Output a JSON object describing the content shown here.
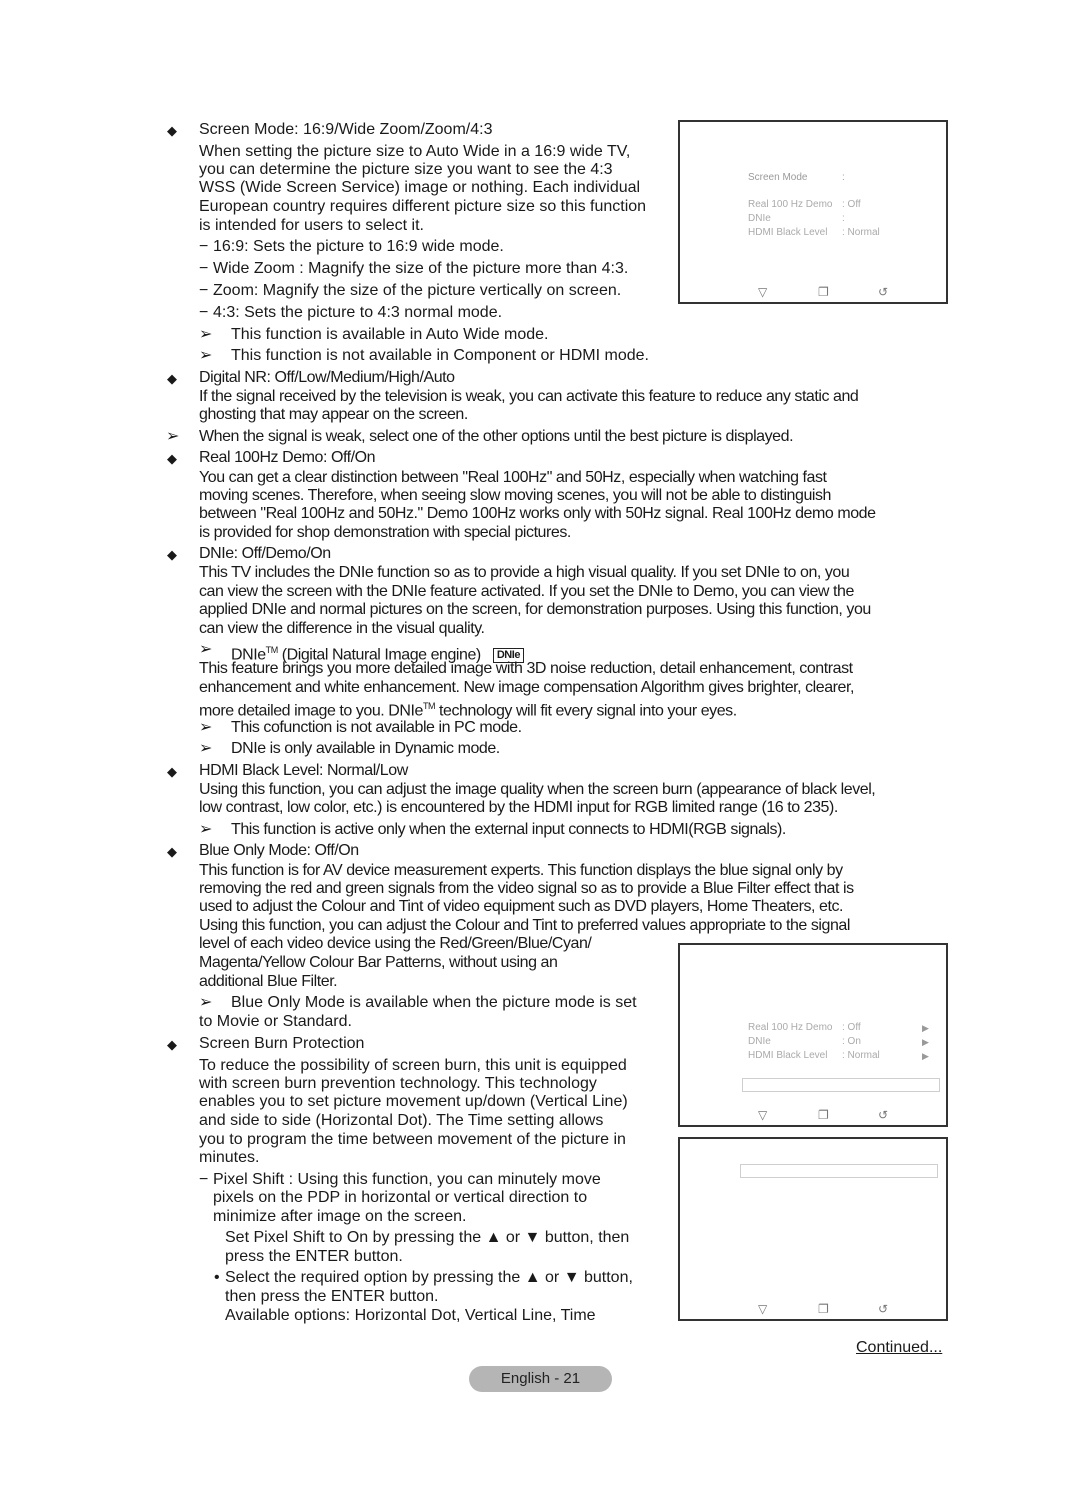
{
  "sections": {
    "screen_mode": {
      "heading": "Screen Mode: 16:9/Wide Zoom/Zoom/4:3",
      "para": [
        "When setting the picture size to Auto Wide in a 16:9 wide TV,",
        "you can determine the picture size you want to see the 4:3",
        "WSS (Wide Screen Service) image or nothing. Each individual",
        "European country requires different picture size so this function",
        "is intended for users to select it."
      ],
      "options": [
        "16:9: Sets the picture to 16:9 wide mode.",
        "Wide Zoom : Magnify the size of the picture more than 4:3.",
        "Zoom:  Magnify the size of the picture vertically on screen.",
        "4:3: Sets the picture to 4:3 normal mode."
      ],
      "notes": [
        "This function is available in Auto Wide  mode.",
        "This function is not available in Component  or HDMI mode."
      ]
    },
    "digital_nr": {
      "heading": "Digital NR: Off/Low/Medium/High/Auto",
      "para": [
        "If the signal received by the television is weak, you can activate this feature to reduce any static and",
        "ghosting that may appear on the screen."
      ],
      "note": "When the signal is weak, select one of the other options until the best picture is displayed."
    },
    "real100hz": {
      "heading": "Real 100Hz Demo: Off/On",
      "para": [
        "You can get a clear distinction between \"Real 100Hz\" and 50Hz, especially when watching fast",
        "moving scenes. Therefore, when seeing slow moving scenes, you will not be able to distinguish",
        "between \"Real 100Hz and 50Hz.\" Demo 100Hz works only with 50Hz signal. Real 100Hz demo mode",
        "is provided for shop demonstration with special pictures."
      ]
    },
    "dnie": {
      "heading": "DNIe: Off/Demo/On",
      "para": [
        "This TV includes the DNIe function so as to provide a high visual quality. If you set DNIe to on, you",
        "can view the screen with the DNIe feature activated. If you set the DNIe to Demo, you can view the",
        "applied DNIe and normal pictures on the screen, for demonstration purposes. Using this function, you",
        "can view the difference in the visual quality."
      ],
      "tm_note_prefix": "DNIe",
      "tm_sup": "TM",
      "tm_note_suffix": " (Digital Natural Image engine)",
      "badge": "DNIe",
      "para2": [
        "This feature brings you more detailed image with 3D noise reduction, detail enhancement, contrast",
        "enhancement and white enhancement. New image compensation Algorithm gives brighter, clearer,"
      ],
      "para2_last_prefix": "more detailed image to you. DNIe",
      "para2_last_sup": "TM",
      "para2_last_suffix": " technology will fit every signal into your eyes.",
      "notes": [
        "This cofunction is not available in PC mode.",
        "DNIe is only available in Dynamic mode."
      ]
    },
    "hdmi_black": {
      "heading": "HDMI Black Level: Normal/Low",
      "para": [
        "Using this function, you can adjust the image quality when the screen burn (appearance of black level,",
        "low contrast, low color, etc.) is encountered by the HDMI input for RGB limited range (16 to 235)."
      ],
      "note": "This function is active only when the external input connects to HDMI(RGB signals)."
    },
    "blue_only": {
      "heading": "Blue Only Mode: Off/On",
      "para": [
        "This function is for AV device measurement experts. This function displays the blue signal only by",
        "removing the red and green signals from the video signal so as to provide a Blue Filter effect that is",
        "used to adjust the Colour and Tint of video equipment such as DVD players, Home Theaters, etc.",
        "Using this function, you can adjust the Colour and Tint to preferred values appropriate to the signal",
        "level of each video device using the Red/Green/Blue/Cyan/",
        "Magenta/Yellow Colour Bar Patterns, without using an",
        "additional Blue Filter."
      ],
      "note_line1": "Blue Only Mode   is available when the picture mode is set",
      "note_line2": "to Movie  or Standard."
    },
    "screen_burn": {
      "heading": "Screen Burn Protection",
      "para": [
        "To reduce the possibility of screen burn, this unit is equipped",
        "with screen burn prevention technology. This technology",
        "enables you to set picture movement up/down (Vertical Line)",
        "and side to side (Horizontal Dot). The Time setting allows",
        "you to program the time between movement of the picture in",
        "minutes."
      ],
      "pixel_shift": [
        "Pixel Shift  : Using this function, you can minutely move",
        "pixels on the PDP in horizontal or vertical direction to",
        "minimize after image on the screen."
      ],
      "step1": [
        "Set Pixel Shift   to On by pressing the ▲ or ▼ button, then",
        "press the ENTER button."
      ],
      "step2": [
        "Select the required option by pressing the ▲ or ▼ button,",
        "then press the ENTER button.",
        "Available options: Horizontal Dot,   Vertical Line,   Time"
      ]
    }
  },
  "osd1": {
    "rows": [
      {
        "label": "Screen Mode",
        "value": ":"
      },
      {
        "label": "Real 100 Hz Demo",
        "value": ": Off"
      },
      {
        "label": "DNIe",
        "value": ":"
      },
      {
        "label": "HDMI Black Level",
        "value": ":  Normal"
      }
    ]
  },
  "osd2": {
    "rows": [
      {
        "label": "Real 100 Hz Demo",
        "value": ": Off",
        "arrow": "▶"
      },
      {
        "label": "DNIe",
        "value": ": On",
        "arrow": "▶"
      },
      {
        "label": "HDMI Black Level",
        "value": ": Normal",
        "arrow": "▶"
      }
    ]
  },
  "osd_icons": {
    "move": "▽",
    "enter": "❐",
    "return": "↺"
  },
  "glyphs": {
    "diamond": "◆",
    "arrow": "➢",
    "dash": "−",
    "dot": "•"
  },
  "footer": {
    "continued": "Continued...",
    "page": "English - 21"
  }
}
